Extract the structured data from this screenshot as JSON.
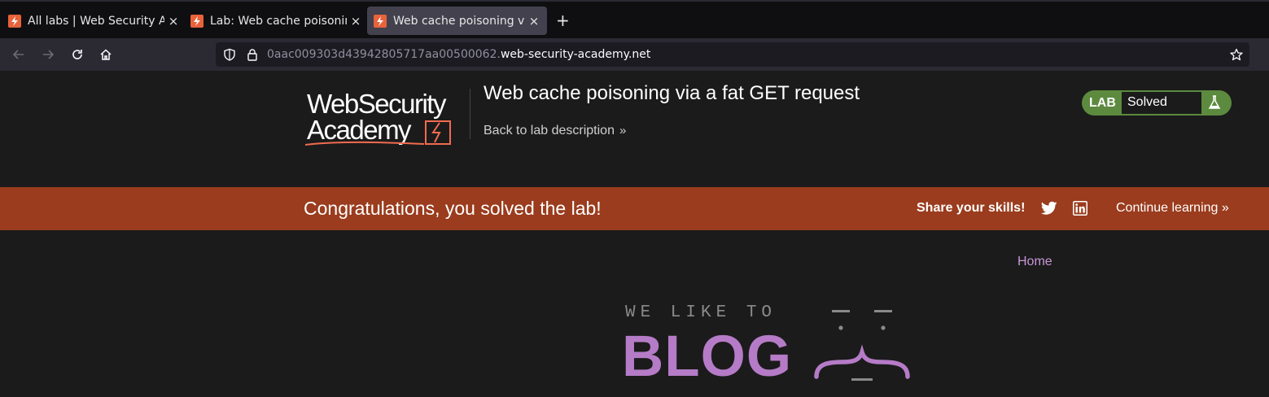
{
  "browser": {
    "tabs": [
      {
        "title": "All labs | Web Security Ac",
        "active": false
      },
      {
        "title": "Lab: Web cache poisonin",
        "active": false
      },
      {
        "title": "Web cache poisoning via",
        "active": true
      }
    ],
    "close_glyph": "×",
    "new_tab_glyph": "+",
    "url_subdomain": "0aac009303d43942805717aa00500062.",
    "url_domain": "web-security-academy.net"
  },
  "academy": {
    "logo_line1": "WebSecurity",
    "logo_line2": "Academy",
    "lab_title": "Web cache poisoning via a fat GET request",
    "back_link": "Back to lab description",
    "back_chevron": "»",
    "status_tag": "LAB",
    "status_value": "Solved"
  },
  "banner": {
    "message": "Congratulations, you solved the lab!",
    "share_label": "Share your skills!",
    "continue_label": "Continue learning",
    "continue_chevron": "»"
  },
  "blog": {
    "home_link": "Home",
    "tagline": "WE LIKE TO",
    "word": "BLOG"
  },
  "colors": {
    "banner": "#9a3c1d",
    "lab_status": "#5c8a3e",
    "link_purple": "#c896d8",
    "blog_purple": "#b57bc7",
    "favicon": "#e8623a"
  },
  "icons": [
    "back-arrow-icon",
    "forward-arrow-icon",
    "reload-icon",
    "home-icon",
    "shield-icon",
    "lock-icon",
    "star-icon",
    "twitter-icon",
    "linkedin-icon",
    "flask-icon"
  ]
}
